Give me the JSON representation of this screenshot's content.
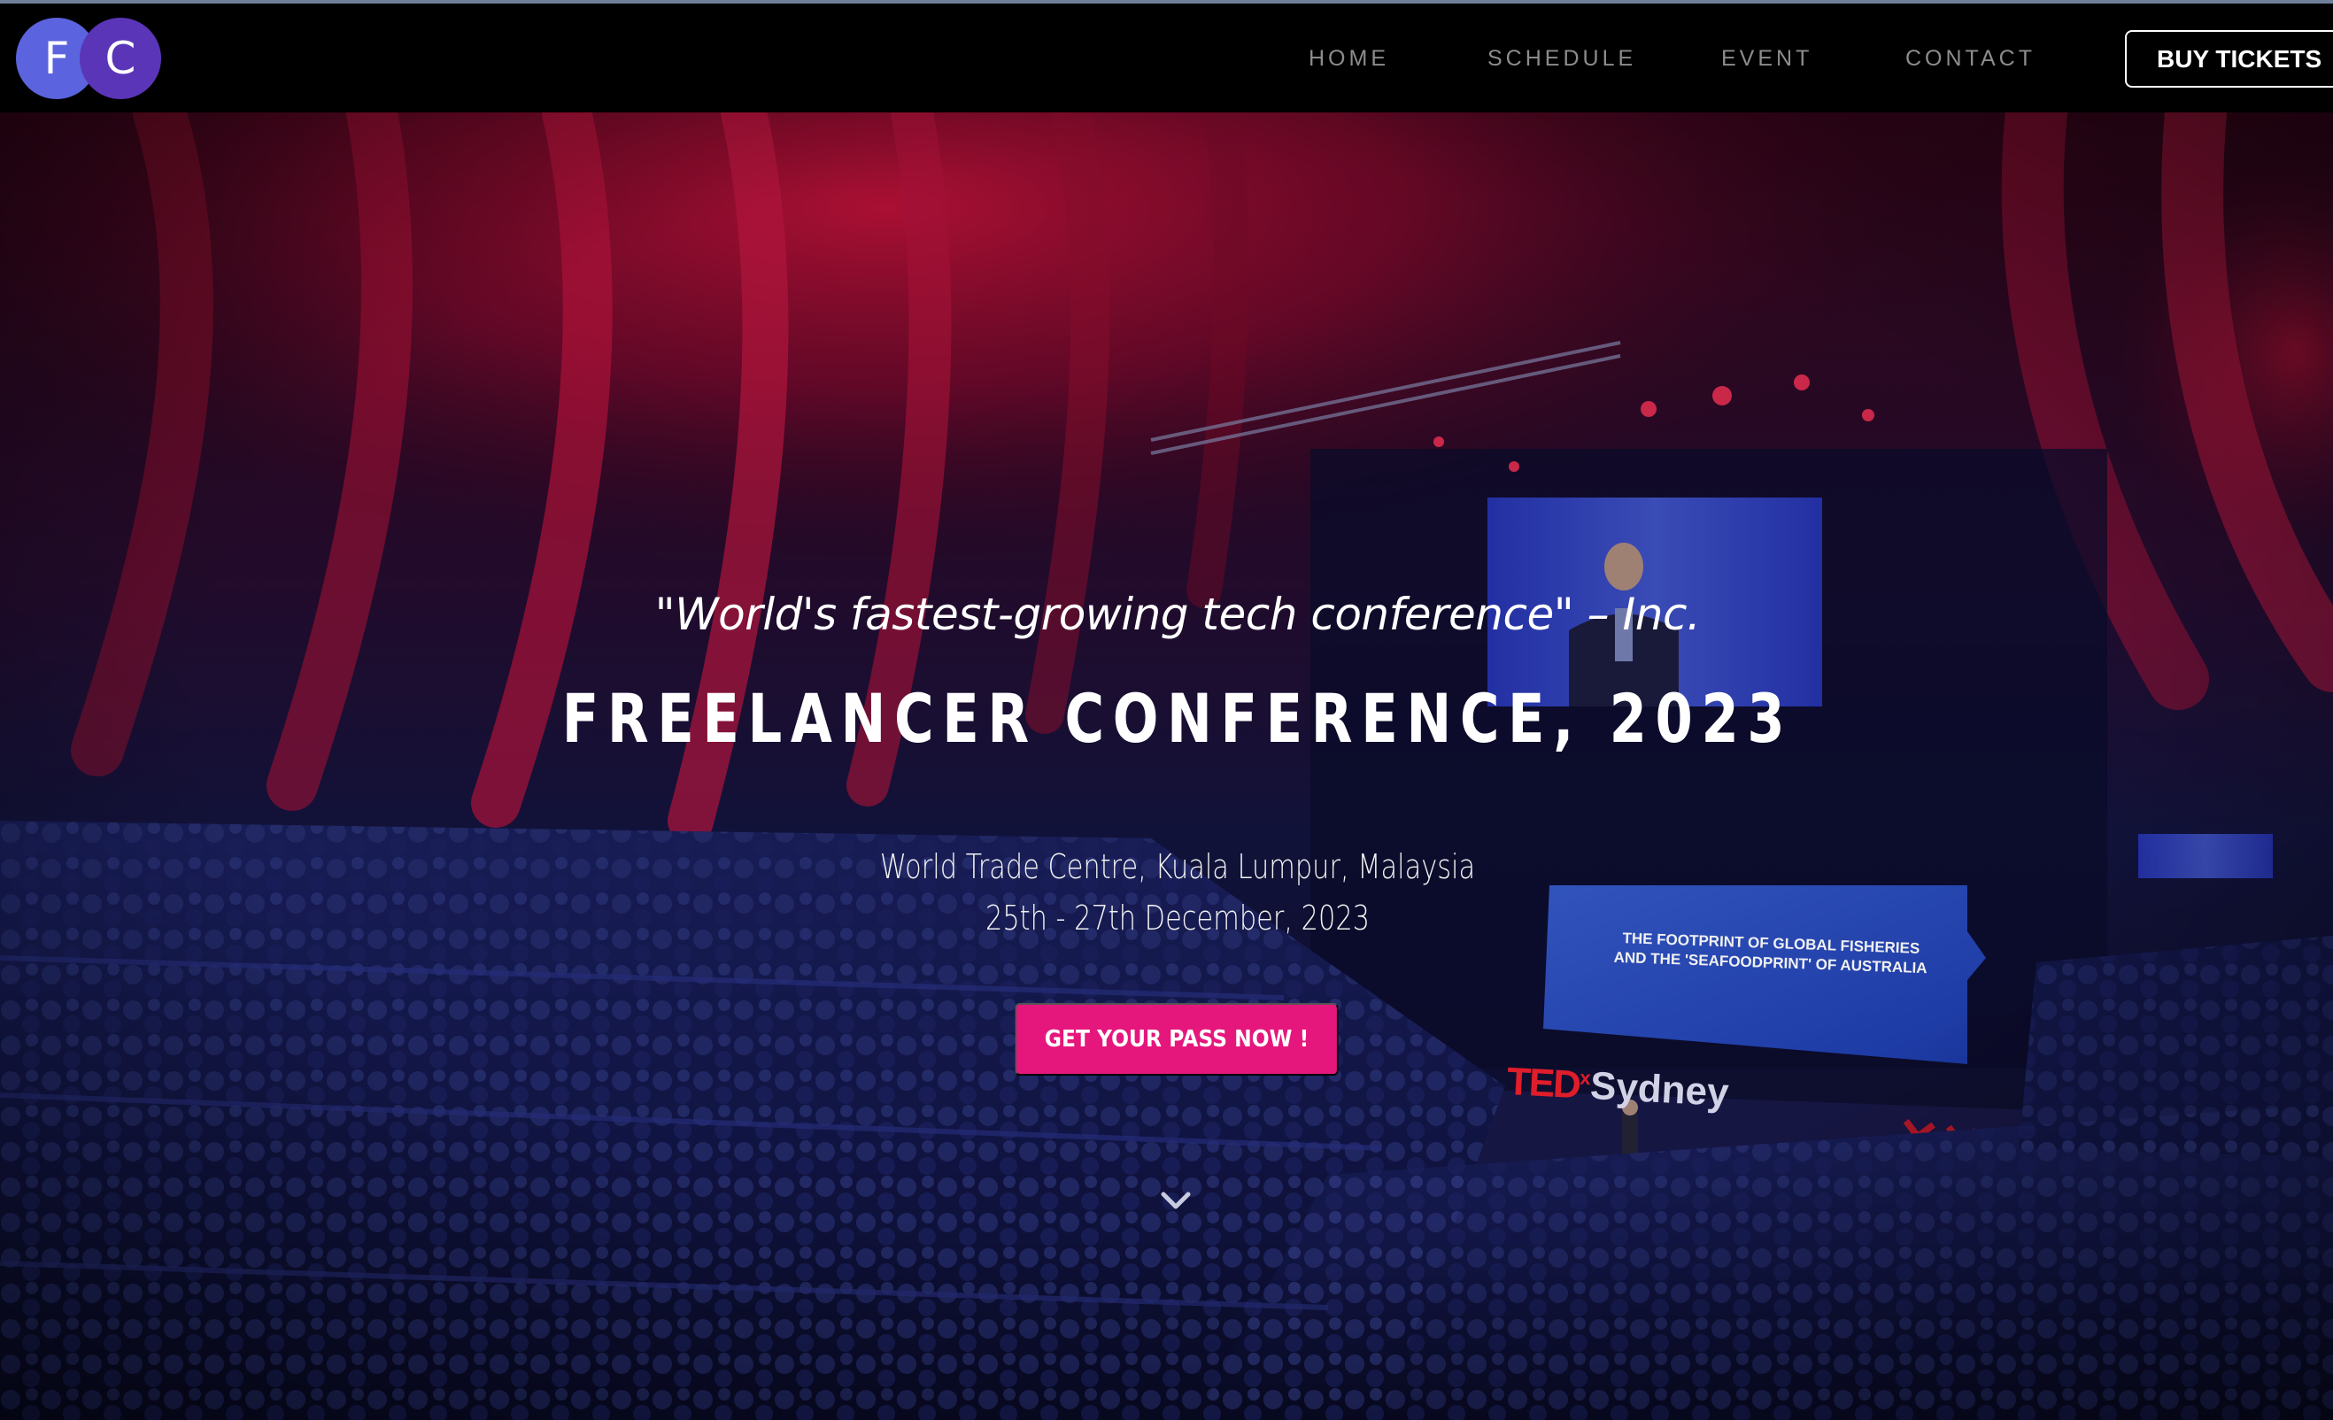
{
  "logo": {
    "letter1": "F",
    "letter2": "C"
  },
  "nav": {
    "items": [
      {
        "label": "HOME"
      },
      {
        "label": "SCHEDULE"
      },
      {
        "label": "EVENT"
      },
      {
        "label": "CONTACT"
      }
    ],
    "buy_tickets": "BUY TICKETS"
  },
  "hero": {
    "quote": "\"World's fastest-growing tech conference\" – Inc.",
    "title": "FREELANCER CONFERENCE, 2023",
    "venue": "World Trade Centre, Kuala Lumpur, Malaysia",
    "dates": "25th - 27th December, 2023",
    "cta": "GET YOUR PASS NOW !",
    "scroll_icon": "chevron-down-icon",
    "stage_screen": {
      "line1": "THE FOOTPRINT OF GLOBAL FISHERIES",
      "line2": "AND THE 'SEAFOODPRINT' OF AUSTRALIA"
    },
    "stage_brand": {
      "prefix": "TED",
      "x": "x",
      "city": "Sydney"
    }
  },
  "colors": {
    "navbar_bg": "#000000",
    "accent_pink": "#e5177d",
    "logo_blue": "#5b63de",
    "logo_purple": "#5a35b8"
  }
}
